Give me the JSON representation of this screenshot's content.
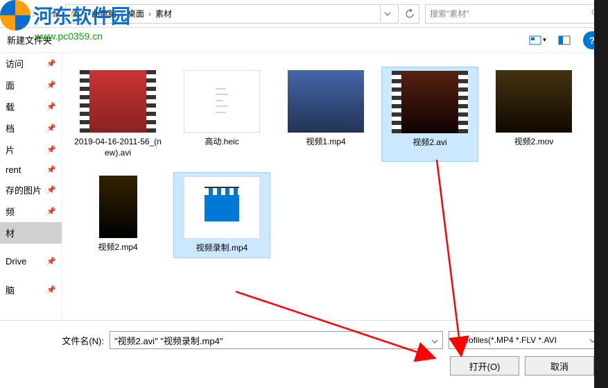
{
  "watermark": {
    "text": "河东软件园",
    "url": "www.pc0359.cn"
  },
  "toolbar": {
    "breadcrumb": {
      "part1": "此电脑",
      "part2": "桌面",
      "part3": "素材"
    },
    "search_placeholder": "搜索\"素材\""
  },
  "subbar": {
    "new_folder": "新建文件夹"
  },
  "sidebar": {
    "items": [
      {
        "label": "访问"
      },
      {
        "label": "面"
      },
      {
        "label": "载"
      },
      {
        "label": "档"
      },
      {
        "label": "片"
      },
      {
        "label": "rent"
      },
      {
        "label": "存的图片"
      },
      {
        "label": "频"
      },
      {
        "label": "材",
        "active": true
      },
      {
        "label": ""
      },
      {
        "label": "Drive"
      },
      {
        "label": ""
      },
      {
        "label": "脑"
      }
    ]
  },
  "files": [
    {
      "name": "2019-04-16-2011-56_(new).avi",
      "type": "video",
      "cls": "photo1"
    },
    {
      "name": "高动.heic",
      "type": "doc"
    },
    {
      "name": "视频1.mp4",
      "type": "photo",
      "cls": "photo2"
    },
    {
      "name": "视频2.avi",
      "type": "video",
      "cls": "photo3",
      "selected": true
    },
    {
      "name": "视频2.mov",
      "type": "photo",
      "cls": "photo4"
    },
    {
      "name": "视频2.mp4",
      "type": "dark"
    },
    {
      "name": "视频录制.mp4",
      "type": "clip",
      "selected": true
    }
  ],
  "footer": {
    "filename_label": "文件名(N):",
    "filename_value": "\"视频2.avi\" \"视频录制.mp4\"",
    "filter": "videofiles(*.MP4 *.FLV *.AVI",
    "open": "打开(O)",
    "cancel": "取消"
  }
}
